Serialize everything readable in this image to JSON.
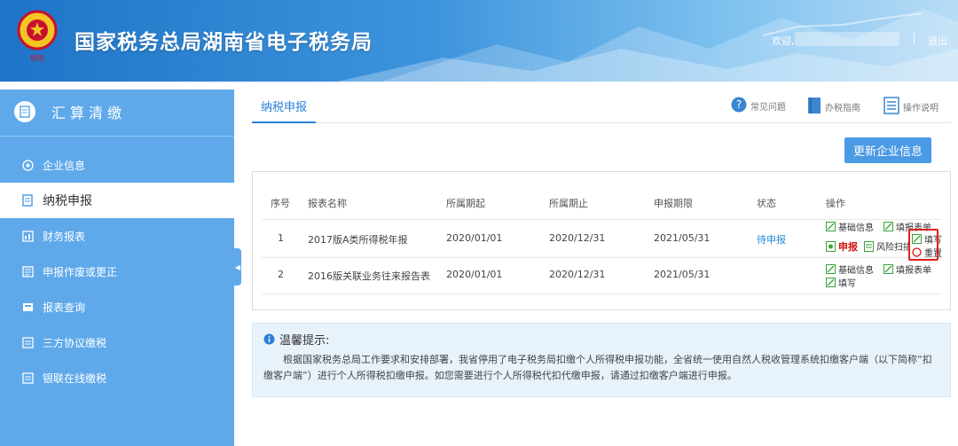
{
  "header": {
    "title": "国家税务总局湖南省电子税务局",
    "welcome": "欢迎,",
    "logout": "退出"
  },
  "sidebar": {
    "title": "汇算清缴",
    "items": [
      {
        "label": "企业信息",
        "icon": "company-info-icon"
      },
      {
        "label": "纳税申报",
        "icon": "tax-filing-icon"
      },
      {
        "label": "财务报表",
        "icon": "financial-report-icon"
      },
      {
        "label": "申报作废或更正",
        "icon": "correction-icon"
      },
      {
        "label": "报表查询",
        "icon": "report-query-icon"
      },
      {
        "label": "三方协议缴税",
        "icon": "agreement-icon"
      },
      {
        "label": "银联在线缴税",
        "icon": "unionpay-icon"
      }
    ]
  },
  "main": {
    "tab": "纳税申报",
    "help": {
      "faq": "常见问题",
      "guide": "办税指南",
      "manual": "操作说明"
    },
    "update_button": "更新企业信息",
    "table": {
      "headers": [
        "序号",
        "报表名称",
        "所属期起",
        "所属期止",
        "申报期限",
        "状态",
        "操作"
      ],
      "rows": [
        {
          "index": "1",
          "name": "2017版A类所得税年报",
          "start": "2020/01/01",
          "end": "2020/12/31",
          "deadline": "2021/05/31",
          "status": "待申报",
          "ops": {
            "basic": "基础信息",
            "fill_form": "填报表单",
            "fill": "填写",
            "declare": "申报",
            "risk": "风险扫描",
            "reset": "重置"
          }
        },
        {
          "index": "2",
          "name": "2016版关联业务往来报告表",
          "start": "2020/01/01",
          "end": "2020/12/31",
          "deadline": "2021/05/31",
          "status": "",
          "ops": {
            "basic": "基础信息",
            "fill_form": "填报表单",
            "fill": "填写"
          }
        }
      ]
    },
    "tip": {
      "title": "温馨提示:",
      "text": "根据国家税务总局工作要求和安排部署，我省停用了电子税务局扣缴个人所得税申报功能，全省统一使用自然人税收管理系统扣缴客户端（以下简称“扣缴客户端”）进行个人所得税扣缴申报。如您需要进行个人所得税代扣代缴申报，请通过扣缴客户端进行申报。"
    }
  },
  "colors": {
    "header_blue": "#1e74c7",
    "sidebar_blue": "#5fa9ea",
    "accent": "#2b7fd6",
    "danger": "#d01414",
    "status_blue": "#1e8bd0"
  }
}
